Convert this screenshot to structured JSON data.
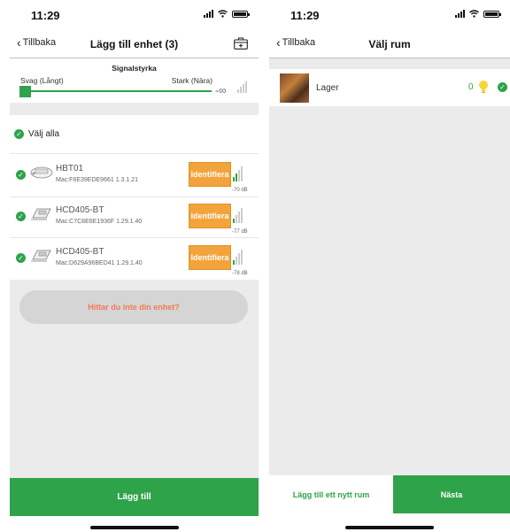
{
  "left_screen": {
    "status": {
      "time": "11:29"
    },
    "nav": {
      "back_label": "Tillbaka",
      "title": "Lägg till enhet (3)",
      "action_icon": "briefcase-plus-icon"
    },
    "signal": {
      "title": "Signalstyrka",
      "weak_label": "Svag (Långt)",
      "strong_label": "Stark (Nära)",
      "infinity_label": "-∞"
    },
    "select_all_label": "Välj alla",
    "devices": [
      {
        "name": "HBT01",
        "mac": "Mac:F6E39EDE9661 1.3.1.21",
        "identify_label": "Identifiera",
        "rssi": "-70 dB",
        "signal_level": 2
      },
      {
        "name": "HCD405-BT",
        "mac": "Mac:C7C8E6E1936F 1.29.1.40",
        "identify_label": "Identifiera",
        "rssi": "-77 dB",
        "signal_level": 1
      },
      {
        "name": "HCD405-BT",
        "mac": "Mac:D629A96BED41 1.29.1.40",
        "identify_label": "Identifiera",
        "rssi": "-78 dB",
        "signal_level": 1
      }
    ],
    "help_label": "Hittar du inte din enhet?",
    "primary_label": "Lägg till"
  },
  "right_screen": {
    "status": {
      "time": "11:29"
    },
    "nav": {
      "back_label": "Tillbaka",
      "title": "Välj rum"
    },
    "rooms": [
      {
        "name": "Lager",
        "count": "0"
      }
    ],
    "add_room_label": "Lägg till ett nytt rum",
    "next_label": "Nästa"
  },
  "colors": {
    "accent_green": "#2ea34a",
    "identify_orange": "#f3a33b",
    "help_text": "#f07a55"
  }
}
